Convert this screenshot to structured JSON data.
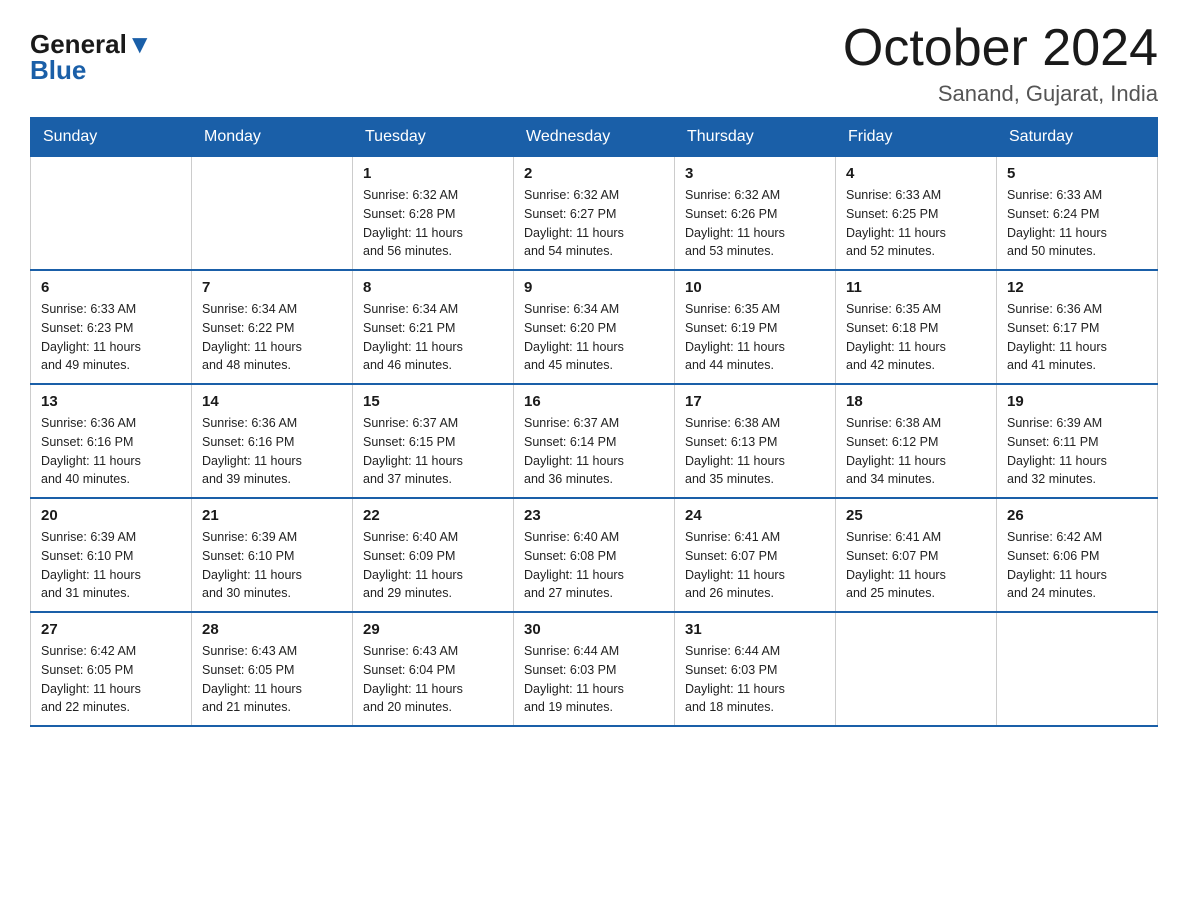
{
  "header": {
    "logo_general": "General",
    "logo_blue": "Blue",
    "month_title": "October 2024",
    "location": "Sanand, Gujarat, India"
  },
  "weekdays": [
    "Sunday",
    "Monday",
    "Tuesday",
    "Wednesday",
    "Thursday",
    "Friday",
    "Saturday"
  ],
  "weeks": [
    [
      {
        "day": "",
        "info": ""
      },
      {
        "day": "",
        "info": ""
      },
      {
        "day": "1",
        "info": "Sunrise: 6:32 AM\nSunset: 6:28 PM\nDaylight: 11 hours\nand 56 minutes."
      },
      {
        "day": "2",
        "info": "Sunrise: 6:32 AM\nSunset: 6:27 PM\nDaylight: 11 hours\nand 54 minutes."
      },
      {
        "day": "3",
        "info": "Sunrise: 6:32 AM\nSunset: 6:26 PM\nDaylight: 11 hours\nand 53 minutes."
      },
      {
        "day": "4",
        "info": "Sunrise: 6:33 AM\nSunset: 6:25 PM\nDaylight: 11 hours\nand 52 minutes."
      },
      {
        "day": "5",
        "info": "Sunrise: 6:33 AM\nSunset: 6:24 PM\nDaylight: 11 hours\nand 50 minutes."
      }
    ],
    [
      {
        "day": "6",
        "info": "Sunrise: 6:33 AM\nSunset: 6:23 PM\nDaylight: 11 hours\nand 49 minutes."
      },
      {
        "day": "7",
        "info": "Sunrise: 6:34 AM\nSunset: 6:22 PM\nDaylight: 11 hours\nand 48 minutes."
      },
      {
        "day": "8",
        "info": "Sunrise: 6:34 AM\nSunset: 6:21 PM\nDaylight: 11 hours\nand 46 minutes."
      },
      {
        "day": "9",
        "info": "Sunrise: 6:34 AM\nSunset: 6:20 PM\nDaylight: 11 hours\nand 45 minutes."
      },
      {
        "day": "10",
        "info": "Sunrise: 6:35 AM\nSunset: 6:19 PM\nDaylight: 11 hours\nand 44 minutes."
      },
      {
        "day": "11",
        "info": "Sunrise: 6:35 AM\nSunset: 6:18 PM\nDaylight: 11 hours\nand 42 minutes."
      },
      {
        "day": "12",
        "info": "Sunrise: 6:36 AM\nSunset: 6:17 PM\nDaylight: 11 hours\nand 41 minutes."
      }
    ],
    [
      {
        "day": "13",
        "info": "Sunrise: 6:36 AM\nSunset: 6:16 PM\nDaylight: 11 hours\nand 40 minutes."
      },
      {
        "day": "14",
        "info": "Sunrise: 6:36 AM\nSunset: 6:16 PM\nDaylight: 11 hours\nand 39 minutes."
      },
      {
        "day": "15",
        "info": "Sunrise: 6:37 AM\nSunset: 6:15 PM\nDaylight: 11 hours\nand 37 minutes."
      },
      {
        "day": "16",
        "info": "Sunrise: 6:37 AM\nSunset: 6:14 PM\nDaylight: 11 hours\nand 36 minutes."
      },
      {
        "day": "17",
        "info": "Sunrise: 6:38 AM\nSunset: 6:13 PM\nDaylight: 11 hours\nand 35 minutes."
      },
      {
        "day": "18",
        "info": "Sunrise: 6:38 AM\nSunset: 6:12 PM\nDaylight: 11 hours\nand 34 minutes."
      },
      {
        "day": "19",
        "info": "Sunrise: 6:39 AM\nSunset: 6:11 PM\nDaylight: 11 hours\nand 32 minutes."
      }
    ],
    [
      {
        "day": "20",
        "info": "Sunrise: 6:39 AM\nSunset: 6:10 PM\nDaylight: 11 hours\nand 31 minutes."
      },
      {
        "day": "21",
        "info": "Sunrise: 6:39 AM\nSunset: 6:10 PM\nDaylight: 11 hours\nand 30 minutes."
      },
      {
        "day": "22",
        "info": "Sunrise: 6:40 AM\nSunset: 6:09 PM\nDaylight: 11 hours\nand 29 minutes."
      },
      {
        "day": "23",
        "info": "Sunrise: 6:40 AM\nSunset: 6:08 PM\nDaylight: 11 hours\nand 27 minutes."
      },
      {
        "day": "24",
        "info": "Sunrise: 6:41 AM\nSunset: 6:07 PM\nDaylight: 11 hours\nand 26 minutes."
      },
      {
        "day": "25",
        "info": "Sunrise: 6:41 AM\nSunset: 6:07 PM\nDaylight: 11 hours\nand 25 minutes."
      },
      {
        "day": "26",
        "info": "Sunrise: 6:42 AM\nSunset: 6:06 PM\nDaylight: 11 hours\nand 24 minutes."
      }
    ],
    [
      {
        "day": "27",
        "info": "Sunrise: 6:42 AM\nSunset: 6:05 PM\nDaylight: 11 hours\nand 22 minutes."
      },
      {
        "day": "28",
        "info": "Sunrise: 6:43 AM\nSunset: 6:05 PM\nDaylight: 11 hours\nand 21 minutes."
      },
      {
        "day": "29",
        "info": "Sunrise: 6:43 AM\nSunset: 6:04 PM\nDaylight: 11 hours\nand 20 minutes."
      },
      {
        "day": "30",
        "info": "Sunrise: 6:44 AM\nSunset: 6:03 PM\nDaylight: 11 hours\nand 19 minutes."
      },
      {
        "day": "31",
        "info": "Sunrise: 6:44 AM\nSunset: 6:03 PM\nDaylight: 11 hours\nand 18 minutes."
      },
      {
        "day": "",
        "info": ""
      },
      {
        "day": "",
        "info": ""
      }
    ]
  ]
}
